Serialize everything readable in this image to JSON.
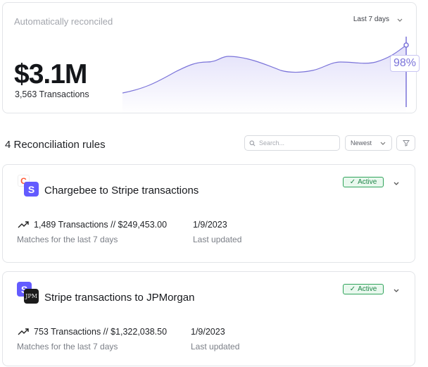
{
  "summary": {
    "title": "Automatically reconciled",
    "range_label": "Last 7 days",
    "amount": "$3.1M",
    "transactions": "3,563 Transactions",
    "percent": "98%",
    "accent": "#7a73d9"
  },
  "rules_section": {
    "title": "4 Reconciliation rules",
    "search_placeholder": "Search...",
    "sort_label": "Newest"
  },
  "rules": [
    {
      "name": "Chargebee to Stripe transactions",
      "status": "Active",
      "logos": [
        "chargebee-logo",
        "stripe-logo"
      ],
      "logo_text": [
        "C",
        "S"
      ],
      "stat": "1,489 Transactions // $249,453.00",
      "stat_sub": "Matches for the last 7 days",
      "date": "1/9/2023",
      "date_sub": "Last updated"
    },
    {
      "name": "Stripe transactions to JPMorgan",
      "status": "Active",
      "logos": [
        "stripe-logo",
        "jpmorgan-logo"
      ],
      "logo_text": [
        "S",
        "JPM"
      ],
      "stat": "753 Transactions // $1,322,038.50",
      "stat_sub": "Matches for the last 7 days",
      "date": "1/9/2023",
      "date_sub": "Last updated"
    }
  ]
}
